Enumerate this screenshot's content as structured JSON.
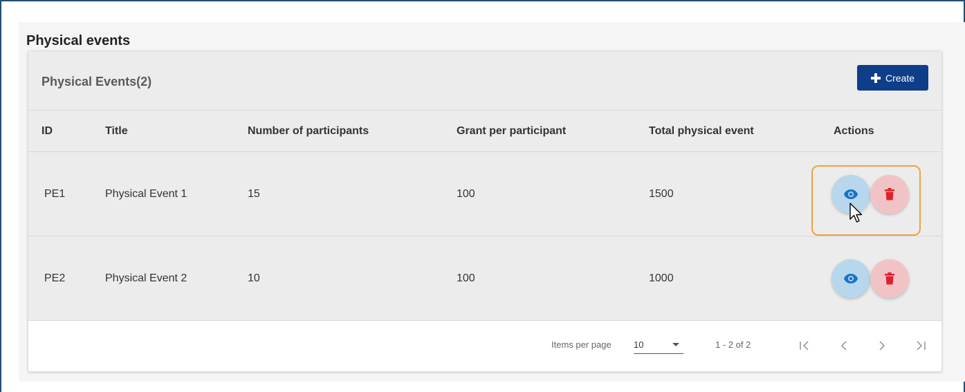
{
  "page": {
    "section_title": "Physical events"
  },
  "card": {
    "title": "Physical Events(2)",
    "create_label": "Create"
  },
  "table": {
    "headers": {
      "id": "ID",
      "title": "Title",
      "participants": "Number of participants",
      "grant": "Grant per participant",
      "total": "Total physical event",
      "actions": "Actions"
    },
    "rows": [
      {
        "id": "PE1",
        "title": "Physical Event 1",
        "participants": "15",
        "grant": "100",
        "total": "1500"
      },
      {
        "id": "PE2",
        "title": "Physical Event 2",
        "participants": "10",
        "grant": "100",
        "total": "1000"
      }
    ]
  },
  "paginator": {
    "items_per_page_label": "Items per page",
    "items_per_page_value": "10",
    "range_label": "1 - 2 of 2"
  },
  "icons": {
    "create": "plus-icon",
    "view": "eye-icon",
    "delete": "trash-icon",
    "first": "first-page-icon",
    "prev": "chevron-left-icon",
    "next": "chevron-right-icon",
    "last": "last-page-icon",
    "cursor": "mouse-pointer-icon"
  },
  "colors": {
    "brand": "#0e3d8a",
    "view_bg": "#b8d7ec",
    "view_icon": "#1a73c8",
    "delete_bg": "#f2c3c6",
    "delete_icon": "#e0202e",
    "highlight": "#f0a040",
    "frame": "#1f4e79"
  }
}
